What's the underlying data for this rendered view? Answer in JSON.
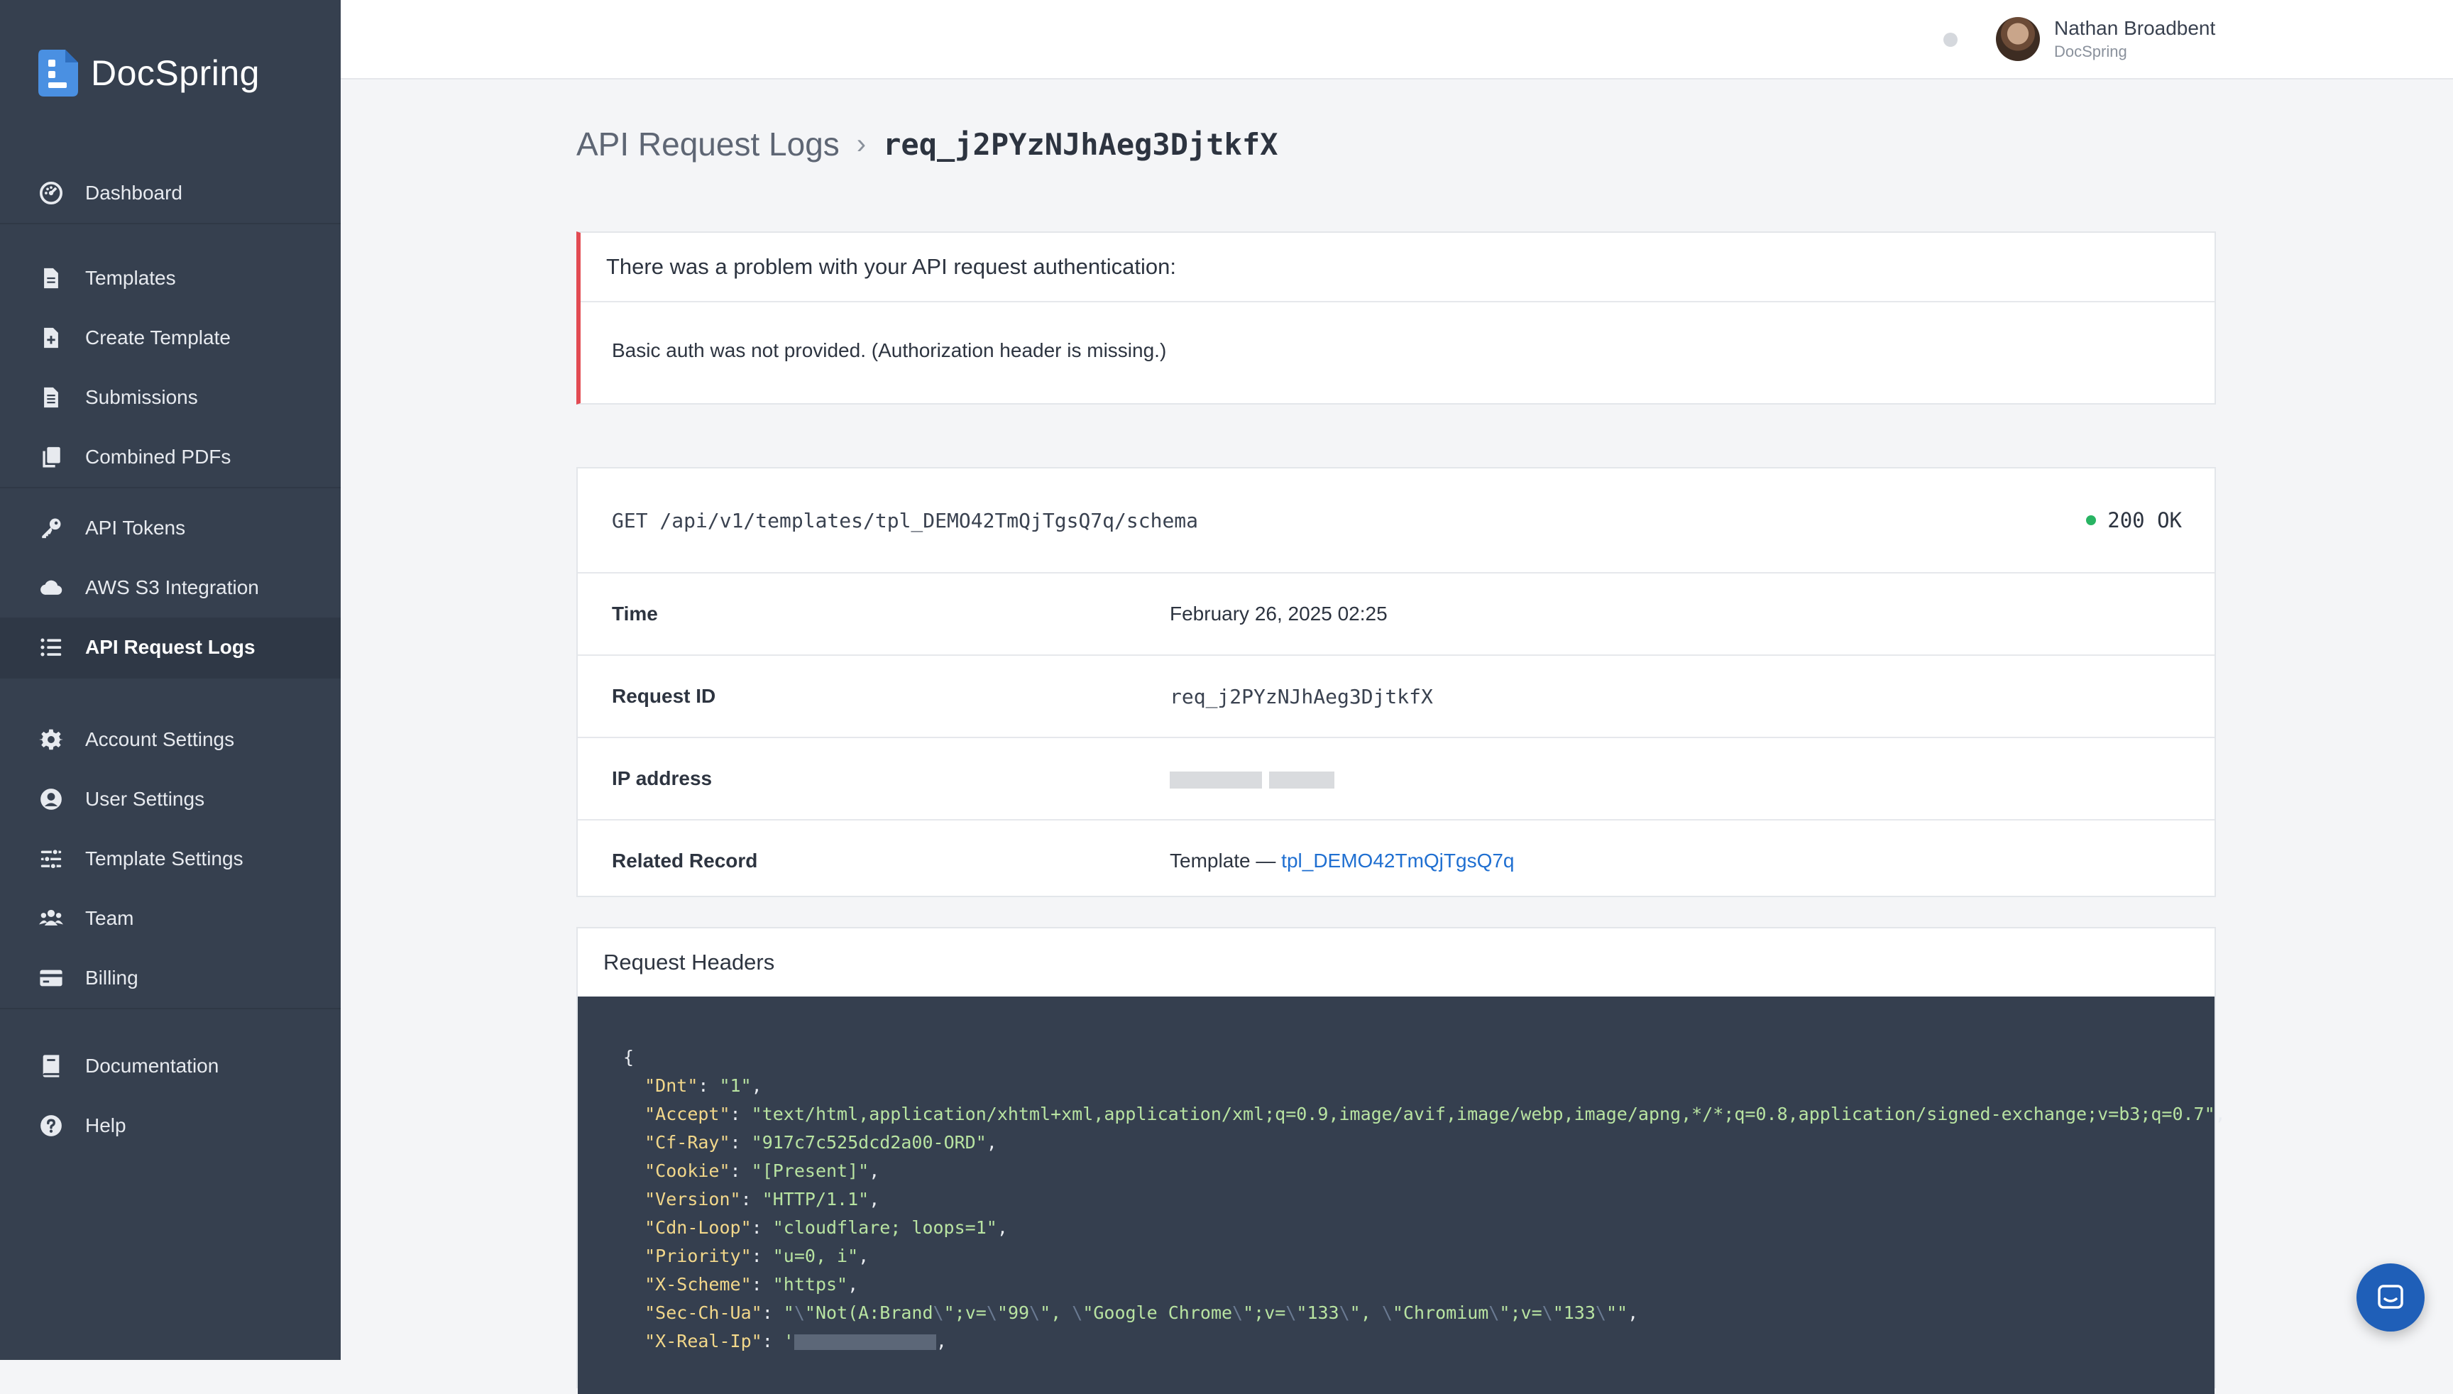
{
  "brand": {
    "name": "DocSpring"
  },
  "sidebar": {
    "groups": [
      [
        {
          "label": "Dashboard",
          "icon": "dashboard-icon"
        }
      ],
      [
        {
          "label": "Templates",
          "icon": "file-icon"
        },
        {
          "label": "Create Template",
          "icon": "file-plus-icon"
        },
        {
          "label": "Submissions",
          "icon": "file-lines-icon"
        },
        {
          "label": "Combined PDFs",
          "icon": "copy-icon"
        }
      ],
      [
        {
          "label": "API Tokens",
          "icon": "key-icon"
        },
        {
          "label": "AWS S3 Integration",
          "icon": "cloud-icon"
        },
        {
          "label": "API Request Logs",
          "icon": "list-icon",
          "active": true
        }
      ],
      [
        {
          "label": "Account Settings",
          "icon": "gear-icon"
        },
        {
          "label": "User Settings",
          "icon": "user-circle-icon"
        },
        {
          "label": "Template Settings",
          "icon": "sliders-icon"
        },
        {
          "label": "Team",
          "icon": "users-icon"
        },
        {
          "label": "Billing",
          "icon": "credit-card-icon"
        }
      ],
      [
        {
          "label": "Documentation",
          "icon": "book-icon"
        },
        {
          "label": "Help",
          "icon": "question-circle-icon"
        }
      ]
    ]
  },
  "user": {
    "name": "Nathan Broadbent",
    "org": "DocSpring"
  },
  "breadcrumb": {
    "parent": "API Request Logs",
    "separator": "›",
    "current": "req_j2PYzNJhAeg3DjtkfX"
  },
  "alert": {
    "title": "There was a problem with your API request authentication:",
    "message": "Basic auth was not provided. (Authorization header is missing.)"
  },
  "request": {
    "line": "GET /api/v1/templates/tpl_DEMO42TmQjTgsQ7q/schema",
    "status": "200 OK",
    "time_label": "Time",
    "time_value": "February 26, 2025 02:25",
    "id_label": "Request ID",
    "id_value": "req_j2PYzNJhAeg3DjtkfX",
    "ip_label": "IP address",
    "related_label": "Related Record",
    "related_prefix": "Template — ",
    "related_link": "tpl_DEMO42TmQjTgsQ7q"
  },
  "headers": {
    "title": "Request Headers",
    "open_brace": "{",
    "entries": [
      {
        "key": "\"Dnt\"",
        "value": "\"1\""
      },
      {
        "key": "\"Accept\"",
        "value": "\"text/html,application/xhtml+xml,application/xml;q=0.9,image/avif,image/webp,image/apng,*/*;q=0.8,application/signed-exchange;v=b3;q=0.7\""
      },
      {
        "key": "\"Cf-Ray\"",
        "value": "\"917c7c525dcd2a00-ORD\""
      },
      {
        "key": "\"Cookie\"",
        "value": "\"[Present]\""
      },
      {
        "key": "\"Version\"",
        "value": "\"HTTP/1.1\""
      },
      {
        "key": "\"Cdn-Loop\"",
        "value": "\"cloudflare; loops=1\""
      },
      {
        "key": "\"Priority\"",
        "value": "\"u=0, i\""
      },
      {
        "key": "\"X-Scheme\"",
        "value": "\"https\""
      }
    ],
    "sec_ch_ua": {
      "key": "\"Sec-Ch-Ua\"",
      "q": "\"",
      "bs": "\\",
      "v1": "\"Not(A:Brand",
      "m1": ";v=",
      "n1": "\"99",
      "v2": "\"Google Chrome",
      "n2": "\"133",
      "v3": "\"Chromium"
    },
    "x_real_ip_key": "\"X-Real-Ip\""
  }
}
